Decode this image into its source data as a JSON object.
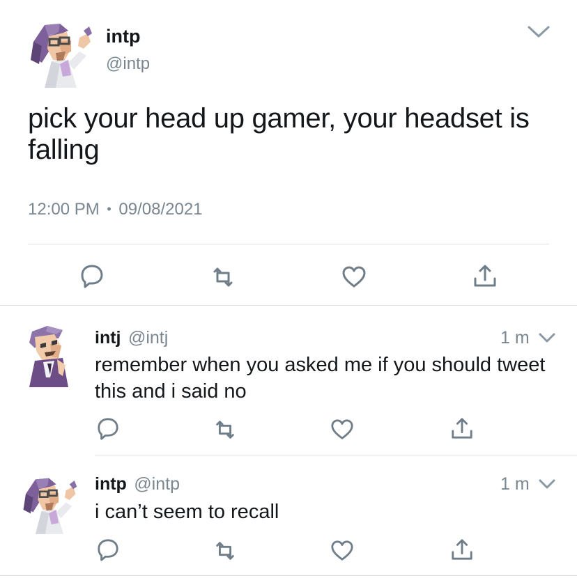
{
  "main_tweet": {
    "display_name": "intp",
    "handle": "@intp",
    "text": "pick your head up gamer, your headset is falling",
    "time": "12:00 PM",
    "separator": "•",
    "date": "09/08/2021",
    "avatar_icon": "intp-avatar-icon",
    "actions": [
      "reply-icon",
      "retweet-icon",
      "like-icon",
      "share-icon"
    ]
  },
  "replies": [
    {
      "display_name": "intj",
      "handle": "@intj",
      "time": "1 m",
      "text": "remember when you asked me if you should tweet this and i said no",
      "avatar_icon": "intj-avatar-icon"
    },
    {
      "display_name": "intp",
      "handle": "@intp",
      "time": "1 m",
      "text": "i can’t seem to recall",
      "avatar_icon": "intp-avatar-icon"
    }
  ],
  "colors": {
    "text": "#14171a",
    "muted": "#7a8791",
    "icon": "#6f7d88",
    "divider": "#dde2e6",
    "avatar_purple": "#8a6fa6",
    "avatar_dark": "#4f3a63"
  }
}
